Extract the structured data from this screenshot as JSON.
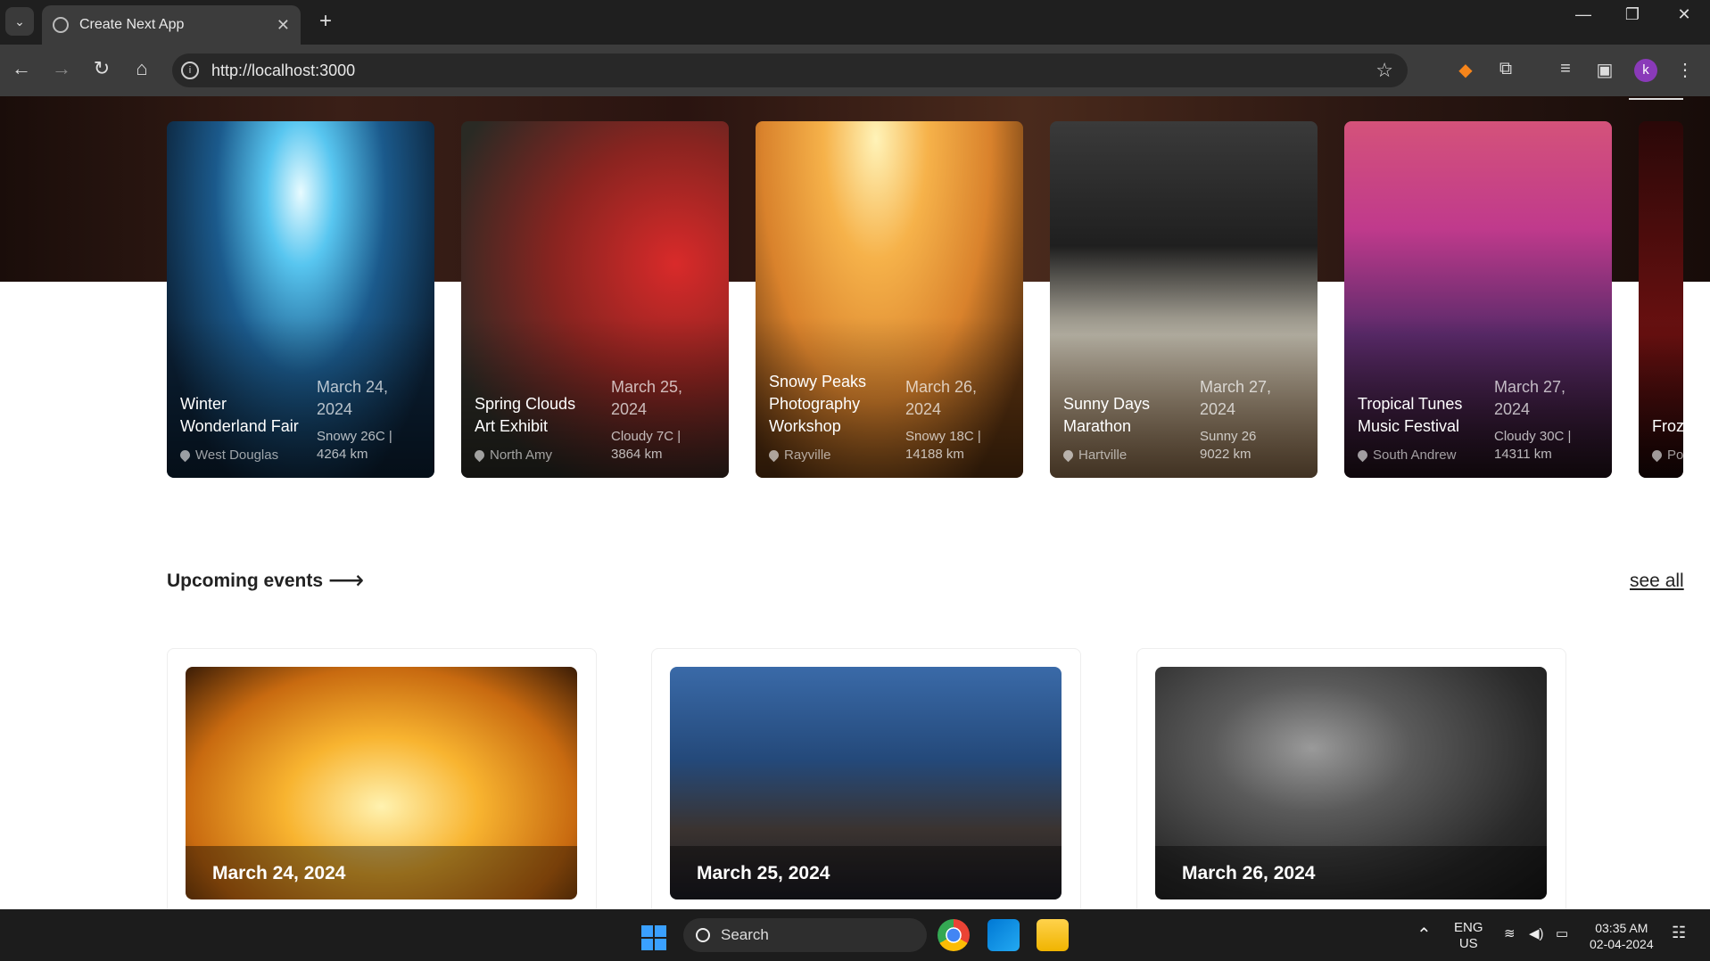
{
  "browser": {
    "tab_title": "Create Next App",
    "url": "http://localhost:3000",
    "profile_initial": "k"
  },
  "cards": [
    {
      "title": "Winter Wonderland Fair",
      "date": "March 24, 2024",
      "weather": "Snowy 26C |",
      "distance": "4264 km",
      "location": "West Douglas"
    },
    {
      "title": "Spring Clouds Art Exhibit",
      "date": "March 25, 2024",
      "weather": "Cloudy 7C |",
      "distance": "3864 km",
      "location": "North Amy"
    },
    {
      "title": "Snowy Peaks Photography Workshop",
      "date": "March 26, 2024",
      "weather": "Snowy 18C |",
      "distance": "14188 km",
      "location": "Rayville"
    },
    {
      "title": "Sunny Days Marathon",
      "date": "March 27, 2024",
      "weather": "Sunny 26",
      "distance": "9022 km",
      "location": "Hartville"
    },
    {
      "title": "Tropical Tunes Music Festival",
      "date": "March 27, 2024",
      "weather": "Cloudy 30C |",
      "distance": "14311 km",
      "location": "South Andrew"
    },
    {
      "title": "Froz Con",
      "date": "",
      "weather": "",
      "distance": "",
      "location": "Po"
    }
  ],
  "upcoming": {
    "title": "Upcoming events",
    "see_all": "see all",
    "events": [
      {
        "date": "March 24, 2024"
      },
      {
        "date": "March 25, 2024"
      },
      {
        "date": "March 26, 2024"
      }
    ]
  },
  "taskbar": {
    "search_label": "Search",
    "lang_top": "ENG",
    "lang_bottom": "US",
    "time": "03:35 AM",
    "date": "02-04-2024"
  }
}
